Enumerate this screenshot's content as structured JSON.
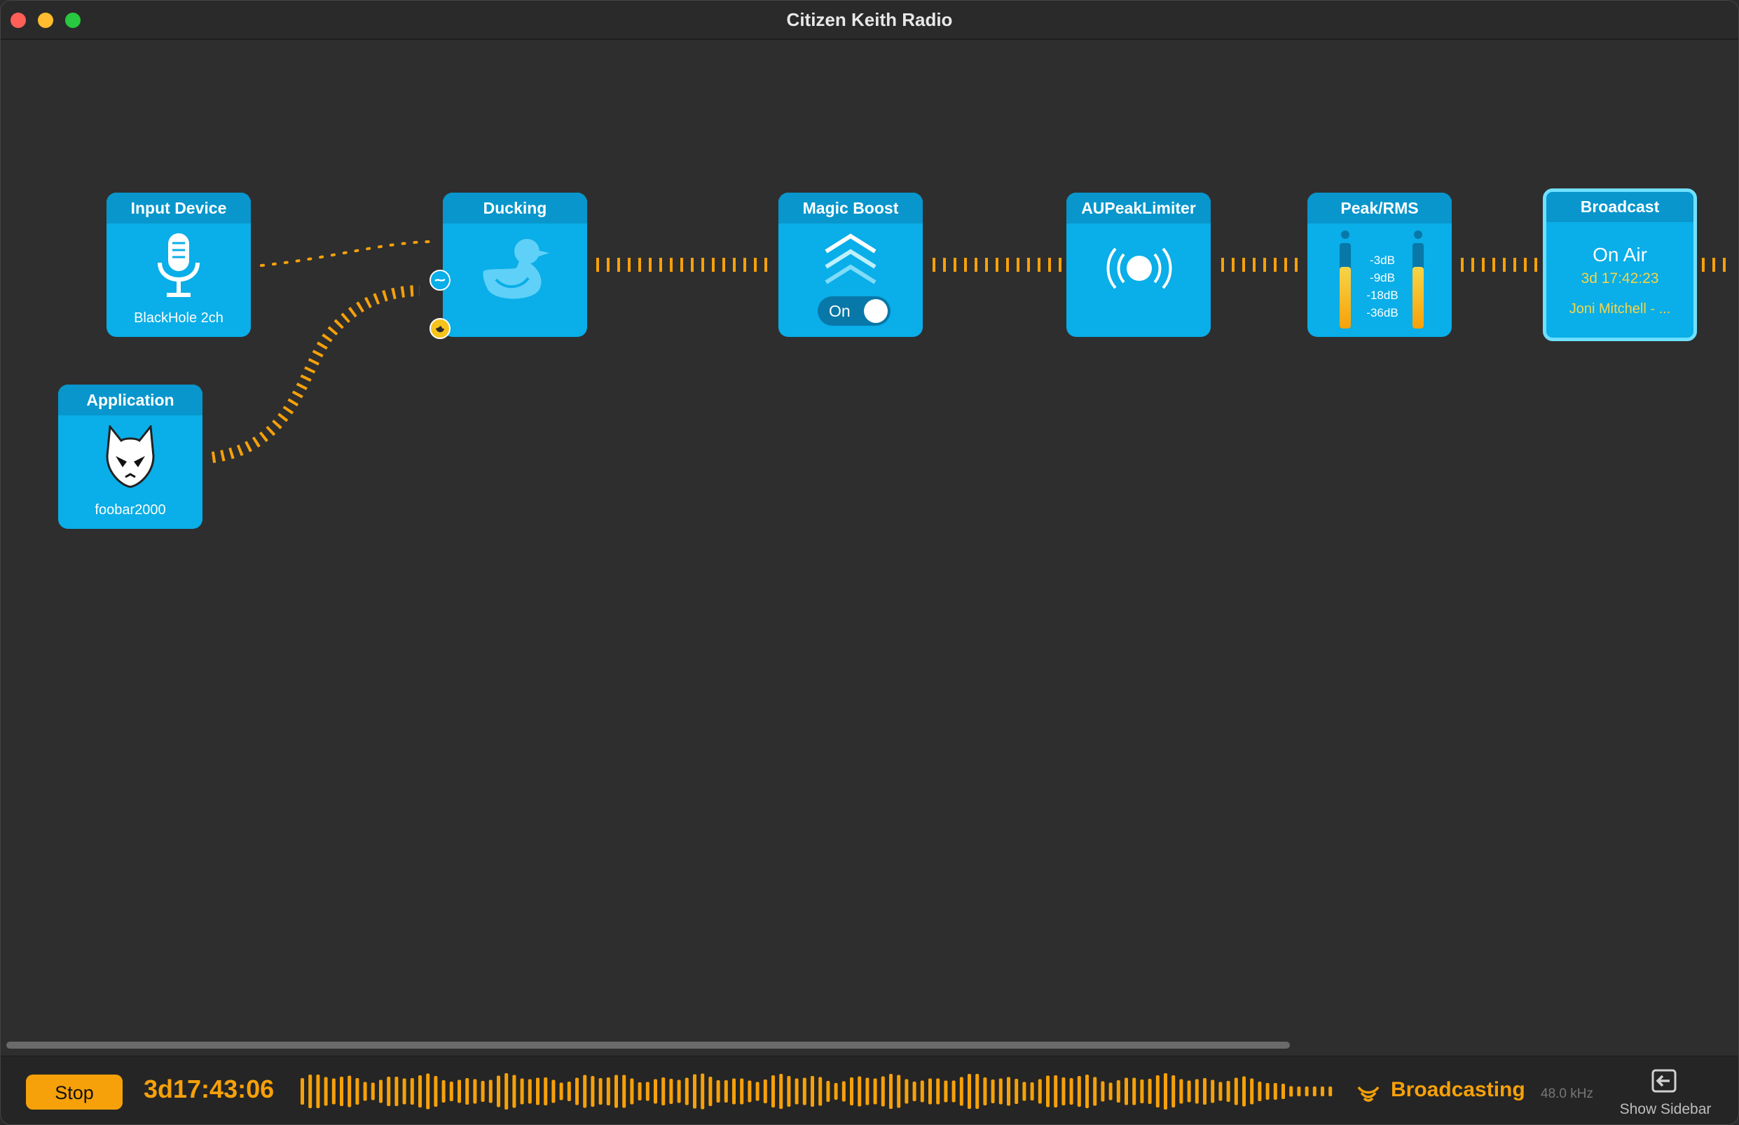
{
  "window": {
    "title": "Citizen Keith Radio"
  },
  "nodes": {
    "input_device": {
      "title": "Input Device",
      "subtitle": "BlackHole 2ch",
      "icon": "microphone-icon"
    },
    "application": {
      "title": "Application",
      "subtitle": "foobar2000",
      "icon": "foobar-alien-icon"
    },
    "ducking": {
      "title": "Ducking",
      "icon": "duck-icon"
    },
    "magic_boost": {
      "title": "Magic Boost",
      "toggle_label": "On",
      "toggle_on": true,
      "icon": "boost-chevrons-icon"
    },
    "peak_limiter": {
      "title": "AUPeakLimiter",
      "icon": "broadcast-wave-icon"
    },
    "peak_rms": {
      "title": "Peak/RMS",
      "scale": [
        "-3dB",
        "-9dB",
        "-18dB",
        "-36dB"
      ],
      "left_level": 0.72,
      "right_level": 0.72
    },
    "broadcast": {
      "title": "Broadcast",
      "status": "On Air",
      "duration": "3d 17:42:23",
      "now_playing": "Joni Mitchell - ..."
    }
  },
  "bottom_bar": {
    "stop_label": "Stop",
    "elapsed": "3d17:43:06",
    "status": "Broadcasting",
    "sample_rate": "48.0 kHz",
    "sidebar_label": "Show Sidebar"
  },
  "colors": {
    "accent": "#f6a10a",
    "node": "#0aaee8",
    "node_header": "#0896cc",
    "selected_border": "#6fe0ff",
    "background": "#2e2e2e"
  }
}
